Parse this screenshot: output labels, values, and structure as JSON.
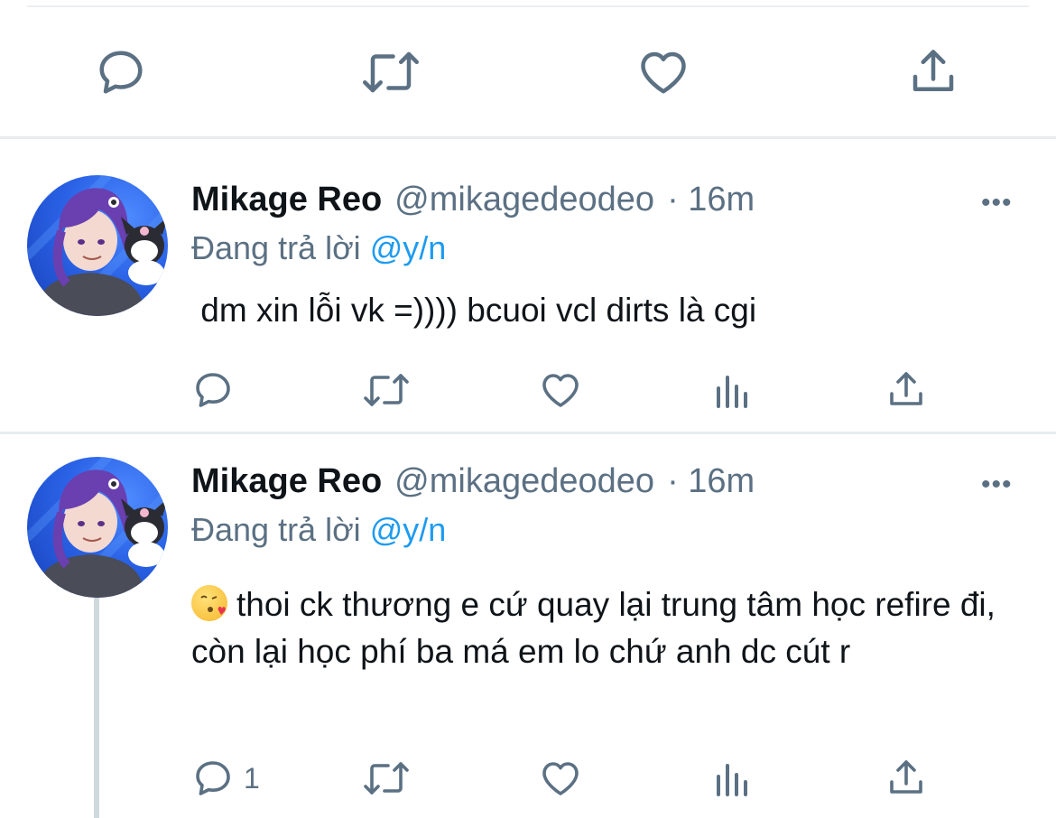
{
  "previous_tweet_actions": {
    "reply": "reply-icon",
    "retweet": "retweet-icon",
    "like": "heart-icon",
    "share": "share-icon"
  },
  "tweets": [
    {
      "author_name": "Mikage Reo",
      "author_handle": "@mikagedeodeo",
      "time": "· 16m",
      "replying_prefix": "Đang trả lời",
      "replying_to": "@y/n",
      "text": " dm xin lỗi vk =)))) bcuoi vcl dirts là cgi",
      "reply_count": "",
      "more": "•••"
    },
    {
      "author_name": "Mikage Reo",
      "author_handle": "@mikagedeodeo",
      "time": "· 16m",
      "replying_prefix": "Đang trả lời",
      "replying_to": "@y/n",
      "emoji": "face-blowing-kiss-emoji",
      "text": "thoi ck thương e cứ quay lại trung tâm học refire đi, còn lại học phí ba má em lo chứ anh dc cút r",
      "reply_count": "1",
      "more": "•••"
    }
  ],
  "colors": {
    "icon": "#5b7083",
    "mention": "#1d9bf0",
    "divider": "#e6ecf0",
    "thread_line": "#cfd9de"
  }
}
